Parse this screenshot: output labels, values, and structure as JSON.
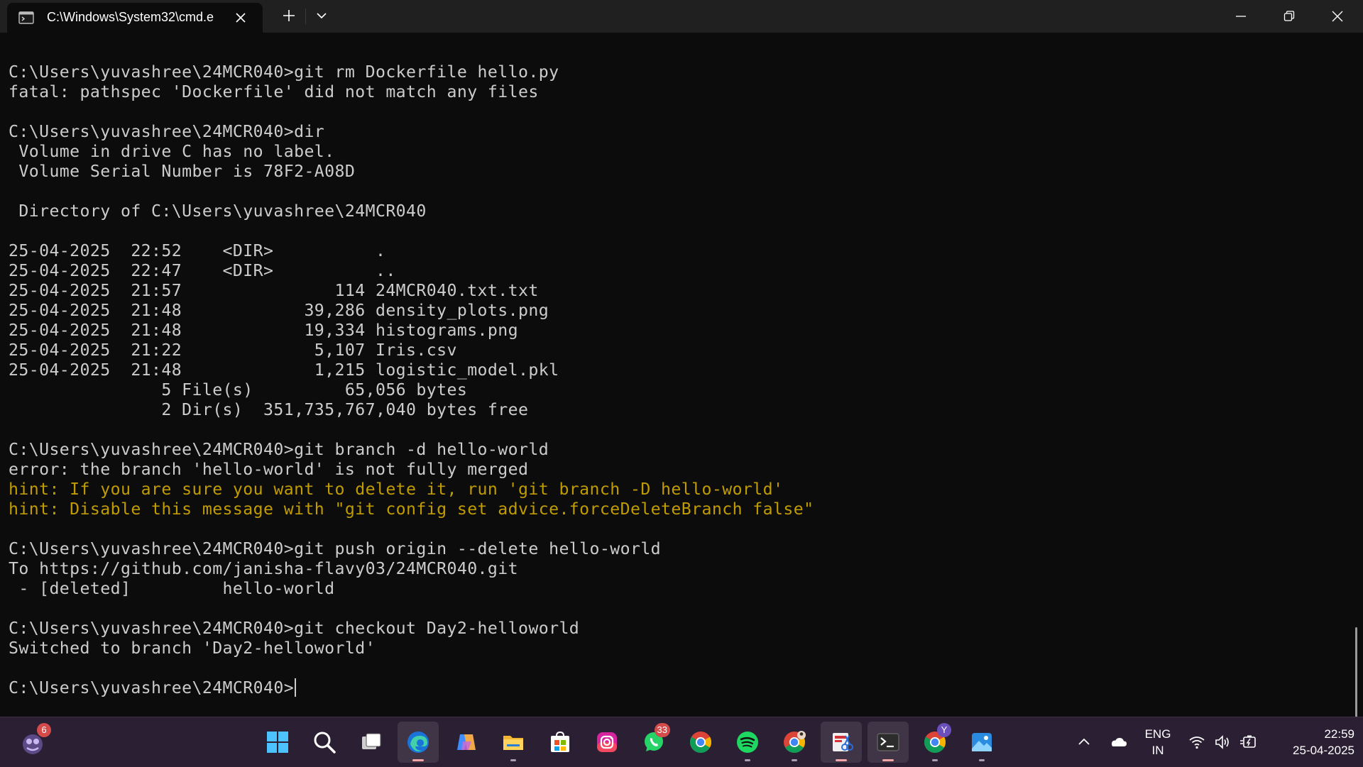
{
  "window": {
    "tab_title": "C:\\Windows\\System32\\cmd.e",
    "tab_icon": "terminal-icon",
    "controls": [
      "minimize-icon",
      "restore-icon",
      "close-icon"
    ]
  },
  "terminal": {
    "lines": [
      {
        "text": "C:\\Users\\yuvashree\\24MCR040>git rm Dockerfile hello.py",
        "style": "normal"
      },
      {
        "text": "fatal: pathspec 'Dockerfile' did not match any files",
        "style": "normal"
      },
      {
        "text": "",
        "style": "normal"
      },
      {
        "text": "C:\\Users\\yuvashree\\24MCR040>dir",
        "style": "normal"
      },
      {
        "text": " Volume in drive C has no label.",
        "style": "normal"
      },
      {
        "text": " Volume Serial Number is 78F2-A08D",
        "style": "normal"
      },
      {
        "text": "",
        "style": "normal"
      },
      {
        "text": " Directory of C:\\Users\\yuvashree\\24MCR040",
        "style": "normal"
      },
      {
        "text": "",
        "style": "normal"
      },
      {
        "text": "25-04-2025  22:52    <DIR>          .",
        "style": "normal"
      },
      {
        "text": "25-04-2025  22:47    <DIR>          ..",
        "style": "normal"
      },
      {
        "text": "25-04-2025  21:57               114 24MCR040.txt.txt",
        "style": "normal"
      },
      {
        "text": "25-04-2025  21:48            39,286 density_plots.png",
        "style": "normal"
      },
      {
        "text": "25-04-2025  21:48            19,334 histograms.png",
        "style": "normal"
      },
      {
        "text": "25-04-2025  21:22             5,107 Iris.csv",
        "style": "normal"
      },
      {
        "text": "25-04-2025  21:48             1,215 logistic_model.pkl",
        "style": "normal"
      },
      {
        "text": "               5 File(s)         65,056 bytes",
        "style": "normal"
      },
      {
        "text": "               2 Dir(s)  351,735,767,040 bytes free",
        "style": "normal"
      },
      {
        "text": "",
        "style": "normal"
      },
      {
        "text": "C:\\Users\\yuvashree\\24MCR040>git branch -d hello-world",
        "style": "normal"
      },
      {
        "text": "error: the branch 'hello-world' is not fully merged",
        "style": "normal"
      },
      {
        "text": "hint: If you are sure you want to delete it, run 'git branch -D hello-world'",
        "style": "hint"
      },
      {
        "text": "hint: Disable this message with \"git config set advice.forceDeleteBranch false\"",
        "style": "hint"
      },
      {
        "text": "",
        "style": "normal"
      },
      {
        "text": "C:\\Users\\yuvashree\\24MCR040>git push origin --delete hello-world",
        "style": "normal"
      },
      {
        "text": "To https://github.com/janisha-flavy03/24MCR040.git",
        "style": "normal"
      },
      {
        "text": " - [deleted]         hello-world",
        "style": "normal"
      },
      {
        "text": "",
        "style": "normal"
      },
      {
        "text": "C:\\Users\\yuvashree\\24MCR040>git checkout Day2-helloworld",
        "style": "normal"
      },
      {
        "text": "Switched to branch 'Day2-helloworld'",
        "style": "normal"
      },
      {
        "text": "",
        "style": "normal"
      },
      {
        "text": "C:\\Users\\yuvashree\\24MCR040>",
        "style": "prompt"
      }
    ],
    "colors": {
      "background": "#0c0c0c",
      "foreground": "#cccccc",
      "hint": "#c19c00"
    }
  },
  "taskbar": {
    "widgets_badge": "6",
    "apps": [
      {
        "name": "start",
        "icon": "windows-start-icon",
        "active": false,
        "running": false
      },
      {
        "name": "search",
        "icon": "search-icon",
        "active": false,
        "running": false
      },
      {
        "name": "task-view",
        "icon": "task-view-icon",
        "active": false,
        "running": false
      },
      {
        "name": "edge",
        "icon": "edge-browser-icon",
        "active": true,
        "running": true,
        "accent": true
      },
      {
        "name": "copilot",
        "icon": "copilot-icon",
        "active": false,
        "running": false
      },
      {
        "name": "file-explorer",
        "icon": "folder-icon",
        "active": false,
        "running": true
      },
      {
        "name": "microsoft-store",
        "icon": "store-icon",
        "active": false,
        "running": false
      },
      {
        "name": "instagram",
        "icon": "instagram-icon",
        "active": false,
        "running": false
      },
      {
        "name": "whatsapp",
        "icon": "whatsapp-icon",
        "active": false,
        "running": false,
        "badge": "33"
      },
      {
        "name": "chrome",
        "icon": "chrome-icon",
        "active": false,
        "running": false
      },
      {
        "name": "spotify",
        "icon": "spotify-icon",
        "active": false,
        "running": true
      },
      {
        "name": "chrome-profile",
        "icon": "chrome-profile-icon",
        "active": false,
        "running": true
      },
      {
        "name": "snipping-tool",
        "icon": "snipping-tool-icon",
        "active": true,
        "running": true,
        "accent": true
      },
      {
        "name": "terminal",
        "icon": "terminal-icon",
        "active": true,
        "running": true,
        "accent": true
      },
      {
        "name": "chrome-y",
        "icon": "chrome-icon",
        "active": false,
        "running": true,
        "badge": "Y"
      },
      {
        "name": "photos",
        "icon": "photos-icon",
        "active": false,
        "running": true
      }
    ],
    "tray": {
      "language": "ENG",
      "region": "IN",
      "time": "22:59",
      "date": "25-04-2025"
    }
  }
}
